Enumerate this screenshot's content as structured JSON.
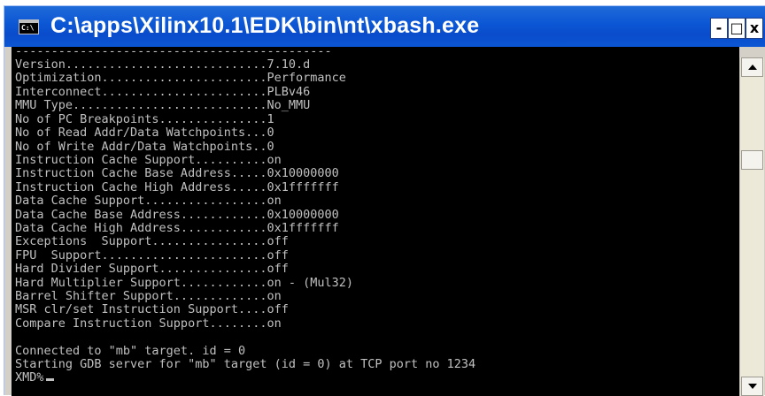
{
  "window": {
    "title": "C:\\apps\\Xilinx10.1\\EDK\\bin\\nt\\xbash.exe",
    "icon": "console-icon",
    "icon_text": "C:\\",
    "min_label": "-",
    "max_label": "□",
    "close_label": "x"
  },
  "console": {
    "lines": [
      "--------------------------------------------",
      "Version............................7.10.d",
      "Optimization.......................Performance",
      "Interconnect.......................PLBv46",
      "MMU Type...........................No_MMU",
      "No of PC Breakpoints...............1",
      "No of Read Addr/Data Watchpoints...0",
      "No of Write Addr/Data Watchpoints..0",
      "Instruction Cache Support..........on",
      "Instruction Cache Base Address.....0x10000000",
      "Instruction Cache High Address.....0x1fffffff",
      "Data Cache Support.................on",
      "Data Cache Base Address............0x10000000",
      "Data Cache High Address............0x1fffffff",
      "Exceptions  Support................off",
      "FPU  Support.......................off",
      "Hard Divider Support...............off",
      "Hard Multiplier Support............on - (Mul32)",
      "Barrel Shifter Support.............on",
      "MSR clr/set Instruction Support....off",
      "Compare Instruction Support........on",
      "",
      "Connected to \"mb\" target. id = 0",
      "Starting GDB server for \"mb\" target (id = 0) at TCP port no 1234",
      "XMD%"
    ]
  },
  "colors": {
    "titlebar": "#0b56d4",
    "console_bg": "#000000",
    "console_text": "#c0c0c0"
  }
}
